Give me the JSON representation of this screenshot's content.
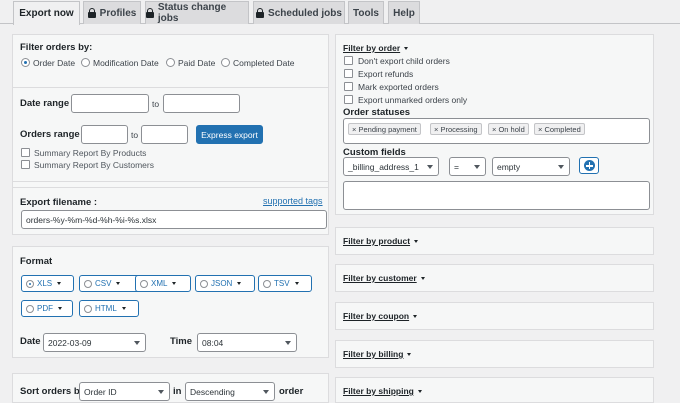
{
  "tabs": [
    {
      "label": "Export now",
      "locked": false
    },
    {
      "label": "Profiles",
      "locked": true
    },
    {
      "label": "Status change jobs",
      "locked": true
    },
    {
      "label": "Scheduled jobs",
      "locked": true
    },
    {
      "label": "Tools",
      "locked": false
    },
    {
      "label": "Help",
      "locked": false
    }
  ],
  "filter_orders": {
    "title": "Filter orders by:",
    "options": [
      "Order Date",
      "Modification Date",
      "Paid Date",
      "Completed Date"
    ],
    "selected": "Order Date"
  },
  "date_range": {
    "label": "Date range",
    "sep": "to",
    "from_value": "",
    "to_value": ""
  },
  "orders_range": {
    "label": "Orders range",
    "sep": "to",
    "from_value": "",
    "to_value": "",
    "express_button": "Express export"
  },
  "summary": {
    "by_products": "Summary Report By Products",
    "by_customers": "Summary Report By Customers"
  },
  "export_filename": {
    "label": "Export filename :",
    "link": "supported tags",
    "value": "orders-%y-%m-%d-%h-%i-%s.xlsx"
  },
  "format": {
    "title": "Format",
    "options": [
      "XLS",
      "CSV",
      "XML",
      "JSON",
      "TSV",
      "PDF",
      "HTML"
    ],
    "selected": "XLS"
  },
  "date_time": {
    "date_label": "Date",
    "date_value": "2022-03-09",
    "time_label": "Time",
    "time_value": "08:04"
  },
  "sort": {
    "label": "Sort orders by",
    "field": "Order ID",
    "in_label": "in",
    "direction": "Descending",
    "suffix": "order"
  },
  "filter_by_order": {
    "title": "Filter by order",
    "checkboxes": [
      "Don't export child orders",
      "Export refunds",
      "Mark exported orders",
      "Export unmarked orders only"
    ],
    "statuses_label": "Order statuses",
    "statuses": [
      "Pending payment",
      "Processing",
      "On hold",
      "Completed"
    ],
    "custom_fields_label": "Custom fields",
    "custom_field": "_billing_address_1",
    "operator": "=",
    "value_placeholder": "empty"
  },
  "collapsed_filters": [
    "Filter by product",
    "Filter by customer",
    "Filter by coupon",
    "Filter by billing",
    "Filter by shipping"
  ],
  "colors": {
    "accent": "#2271b1",
    "background": "#f0f0f1",
    "panel": "#f6f7f7"
  }
}
